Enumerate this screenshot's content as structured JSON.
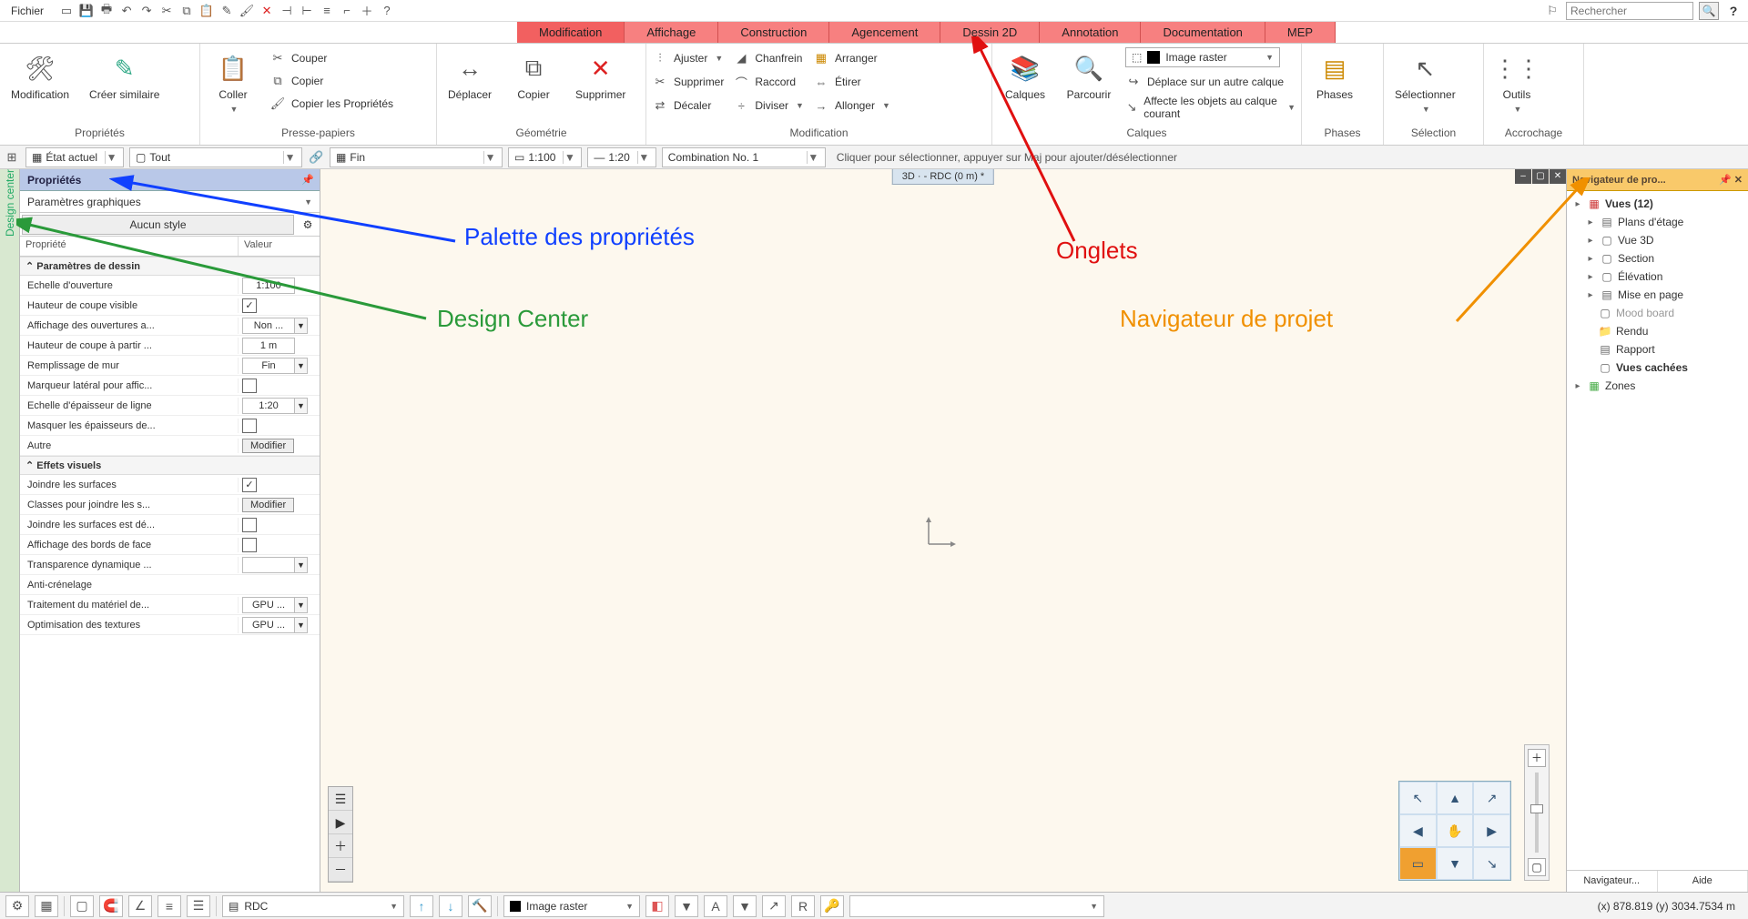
{
  "menu": {
    "file": "Fichier"
  },
  "search": {
    "placeholder": "Rechercher"
  },
  "tabs": [
    "Modification",
    "Affichage",
    "Construction",
    "Agencement",
    "Dessin 2D",
    "Annotation",
    "Documentation",
    "MEP"
  ],
  "ribbon": {
    "props": {
      "mod": "Modification",
      "sim": "Créer similaire",
      "group_label": "Propriétés"
    },
    "clip": {
      "paste": "Coller",
      "cut": "Couper",
      "copy": "Copier",
      "copyprops": "Copier les Propriétés",
      "group_label": "Presse-papiers"
    },
    "geom": {
      "move": "Déplacer",
      "copy": "Copier",
      "del": "Supprimer",
      "group_label": "Géométrie"
    },
    "modif": {
      "ajuster": "Ajuster",
      "chanfrein": "Chanfrein",
      "arranger": "Arranger",
      "supprimer": "Supprimer",
      "raccord": "Raccord",
      "etirer": "Étirer",
      "decaler": "Décaler",
      "diviser": "Diviser",
      "allonger": "Allonger",
      "group_label": "Modification"
    },
    "layers": {
      "calques": "Calques",
      "parcourir": "Parcourir",
      "raster": "Image raster",
      "move_other": "Déplace sur un autre calque",
      "affect": "Affecte les objets au calque courant",
      "group_label": "Calques"
    },
    "phases": {
      "phases": "Phases",
      "group_label": "Phases"
    },
    "select": {
      "sel": "Sélectionner",
      "group_label": "Sélection"
    },
    "snap": {
      "outils": "Outils",
      "group_label": "Accrochage"
    }
  },
  "optbar": {
    "etat": "État actuel",
    "tout": "Tout",
    "fin": "Fin",
    "scale1": "1:100",
    "scale2": "1:20",
    "combo": "Combination No. 1",
    "hint": "Cliquer pour sélectionner, appuyer sur Maj pour ajouter/désélectionner"
  },
  "props": {
    "title": "Propriétés",
    "combo": "Paramètres graphiques",
    "style": "Aucun style",
    "col_prop": "Propriété",
    "col_val": "Valeur",
    "sec1": "Paramètres de dessin",
    "r_echelle_ouv": "Echelle d'ouverture",
    "v_echelle_ouv": "1:100",
    "r_hauteur_vis": "Hauteur de coupe visible",
    "r_aff_ouv": "Affichage des ouvertures a...",
    "v_aff_ouv": "Non ...",
    "r_hauteur_partir": "Hauteur de coupe à partir ...",
    "v_hauteur_partir": "1 m",
    "r_rempl": "Remplissage de mur",
    "v_rempl": "Fin",
    "r_marqueur": "Marqueur latéral pour affic...",
    "r_ech_ep": "Echelle d'épaisseur de ligne",
    "v_ech_ep": "1:20",
    "r_masq": "Masquer les épaisseurs de...",
    "r_autre": "Autre",
    "v_modifier": "Modifier",
    "sec2": "Effets visuels",
    "r_joindre": "Joindre les surfaces",
    "r_classes": "Classes pour joindre les s...",
    "r_joindre_def": "Joindre les surfaces est dé...",
    "r_aff_bords": "Affichage des bords de face",
    "r_transp": "Transparence dynamique ...",
    "r_anti": "Anti-crénelage",
    "r_gpu1": "Traitement du matériel de...",
    "v_gpu": "GPU ...",
    "r_gpu2": "Optimisation des textures"
  },
  "designcenter": "Design center",
  "viewtab": "3D · - RDC (0 m) *",
  "nav": {
    "title": "Navigateur de pro...",
    "vues": "Vues (12)",
    "items": [
      "Plans d'étage",
      "Vue 3D",
      "Section",
      "Élévation",
      "Mise en page",
      "Mood board",
      "Rendu",
      "Rapport",
      "Vues cachées"
    ],
    "zones": "Zones",
    "foot1": "Navigateur...",
    "foot2": "Aide"
  },
  "status": {
    "rdc": "RDC",
    "raster": "Image raster",
    "coords": "(x) 878.819   (y) 3034.7534 m"
  },
  "annot": {
    "palette": "Palette des propriétés",
    "onglets": "Onglets",
    "dc": "Design Center",
    "navproj": "Navigateur de projet"
  }
}
